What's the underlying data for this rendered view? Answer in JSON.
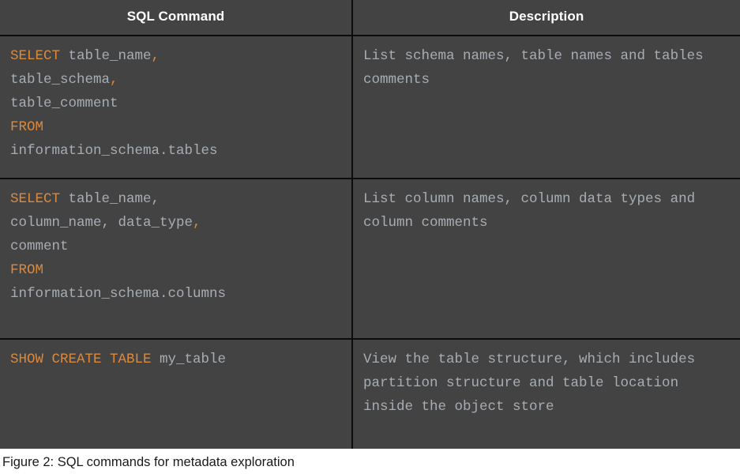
{
  "figure": {
    "caption": "Figure 2: SQL commands for metadata exploration"
  },
  "colors": {
    "table_background": "#434343",
    "border": "#0c0c0c",
    "header_text": "#ffffff",
    "body_text": "#a8adb3",
    "keyword": "#d98a3f",
    "page_background": "#ffffff",
    "caption_text": "#1a1a1a"
  },
  "table": {
    "headers": {
      "command": "SQL Command",
      "description": "Description"
    },
    "rows": [
      {
        "command_plain": "SELECT table_name, table_schema, table_comment\nFROM\ninformation_schema.tables",
        "command_tokens": [
          {
            "text": "SELECT",
            "kind": "keyword"
          },
          {
            "text": " table_name",
            "kind": "identifier"
          },
          {
            "text": ",",
            "kind": "keyword"
          },
          {
            "text": "\ntable_schema",
            "kind": "identifier"
          },
          {
            "text": ",",
            "kind": "keyword"
          },
          {
            "text": "\ntable_comment\n",
            "kind": "identifier"
          },
          {
            "text": "FROM",
            "kind": "keyword"
          },
          {
            "text": "\ninformation_schema.tables",
            "kind": "identifier"
          }
        ],
        "description": "List schema names, table names and tables comments"
      },
      {
        "command_plain": "SELECT table_name, column_name, data_type, comment\nFROM\ninformation_schema.columns",
        "command_tokens": [
          {
            "text": "SELECT",
            "kind": "keyword"
          },
          {
            "text": " table_name,\ncolumn_name, data_type",
            "kind": "identifier"
          },
          {
            "text": ",",
            "kind": "keyword"
          },
          {
            "text": "\ncomment\n",
            "kind": "identifier"
          },
          {
            "text": "FROM",
            "kind": "keyword"
          },
          {
            "text": "\ninformation_schema.columns",
            "kind": "identifier"
          }
        ],
        "description": "List column names, column data types and column comments"
      },
      {
        "command_plain": "SHOW CREATE TABLE my_table",
        "command_tokens": [
          {
            "text": "SHOW CREATE TABLE",
            "kind": "keyword"
          },
          {
            "text": " my_table",
            "kind": "identifier"
          }
        ],
        "description": "View the table structure, which includes partition structure and table location inside the object store"
      }
    ]
  }
}
